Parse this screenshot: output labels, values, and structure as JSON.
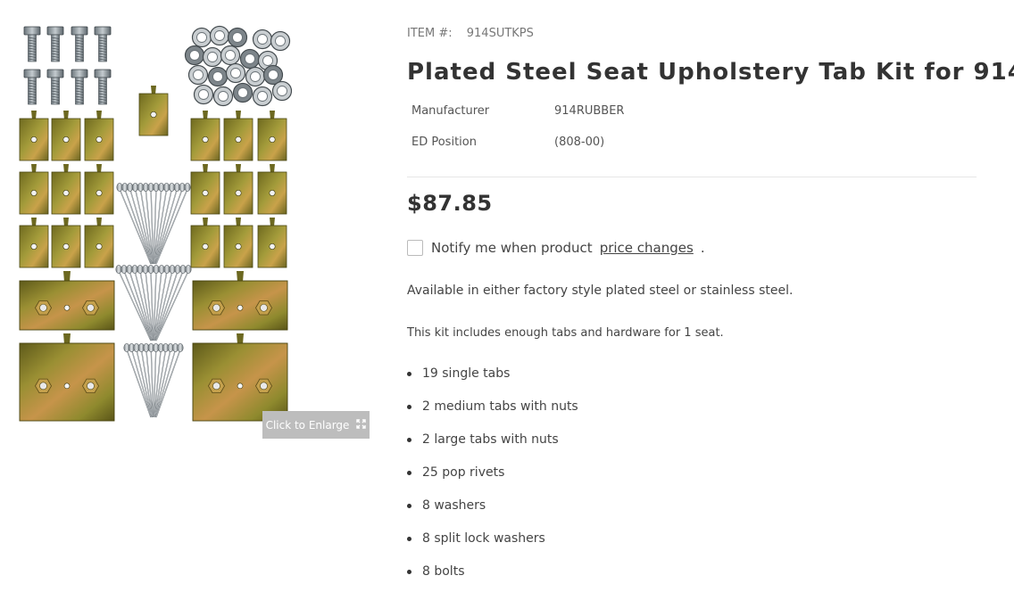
{
  "gallery": {
    "enlarge_label": "Click to Enlarge",
    "enlarge_icon": "expand-arrows-icon",
    "image_parts": [
      "bolts",
      "washers",
      "split-lock-washers",
      "single-tabs",
      "medium-tabs-with-nuts",
      "large-tabs-with-nuts",
      "pop-rivets"
    ]
  },
  "product": {
    "item_label": "ITEM #:",
    "sku": "914SUTKPS",
    "title": "Plated Steel Seat Upholstery Tab Kit for 914",
    "specs": [
      {
        "label": "Manufacturer",
        "value": "914RUBBER"
      },
      {
        "label": "ED Position",
        "value": "(808-00)"
      }
    ],
    "price": "$87.85",
    "notify": {
      "text": "Notify me when product",
      "link": "price changes",
      "suffix": "."
    },
    "description": "Available in either factory style plated steel or stainless steel.",
    "includes": "This kit includes enough tabs and hardware for 1 seat.",
    "features": [
      "19 single tabs",
      "2 medium tabs with nuts",
      "2 large tabs with nuts",
      "25 pop rivets",
      "8 washers",
      "8 split lock washers",
      "8 bolts"
    ]
  },
  "colors": {
    "zinc_plated": "#8a8a2c",
    "steel": "#9aa3a8",
    "enlarge_bg": "#bdbdbd",
    "text": "#444444",
    "title": "#333333"
  }
}
